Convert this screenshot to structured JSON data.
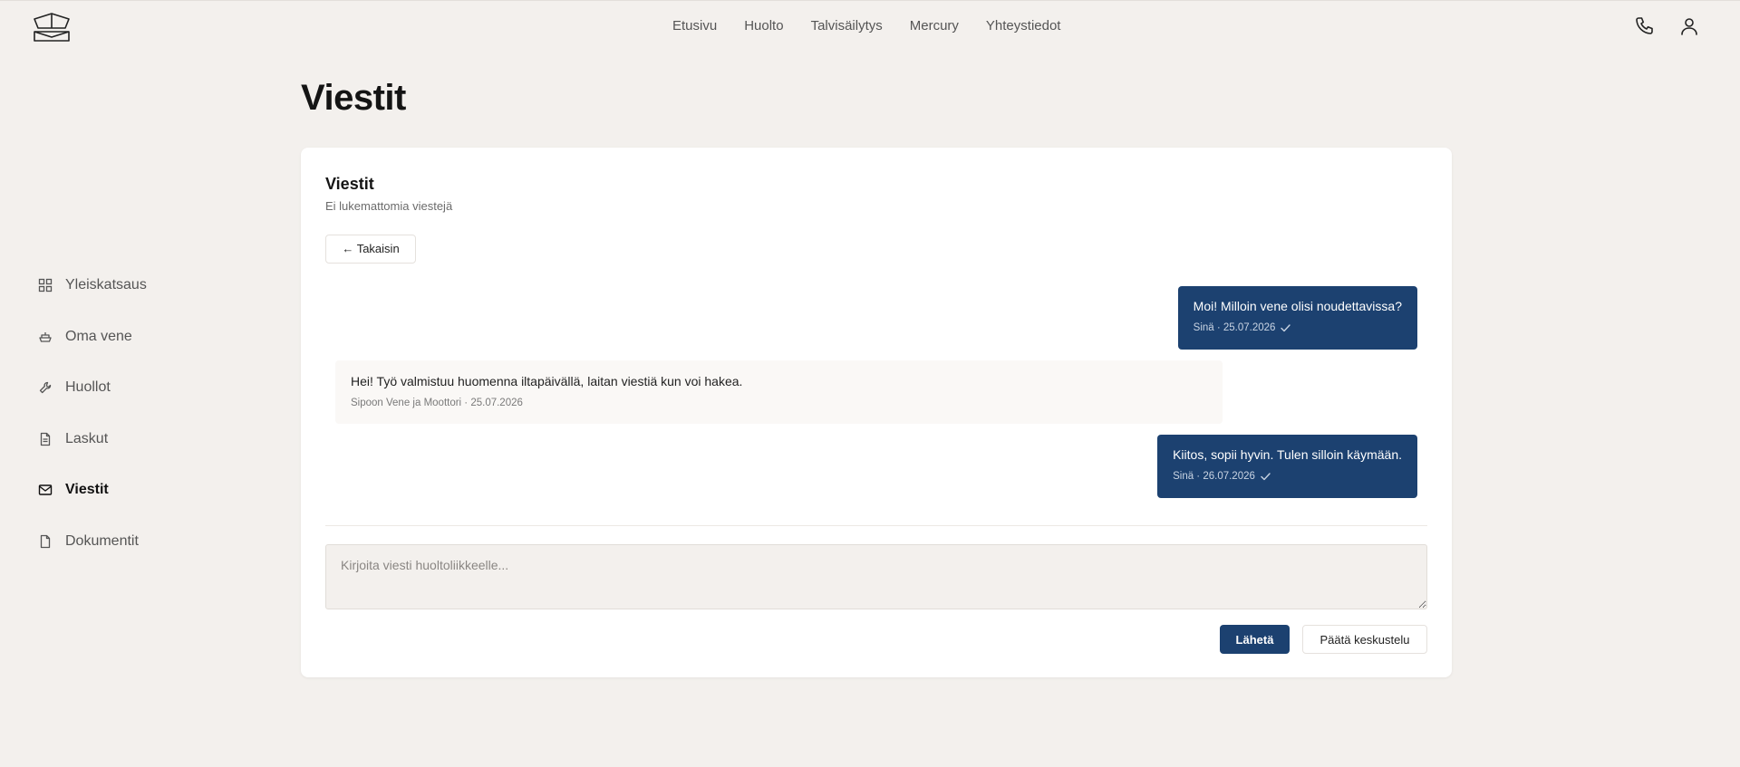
{
  "nav": {
    "items": [
      "Etusivu",
      "Huolto",
      "Talvisäilytys",
      "Mercury",
      "Yhteystiedot"
    ]
  },
  "header_icons": [
    "phone-icon",
    "user-icon"
  ],
  "sidebar": {
    "items": [
      {
        "label": "Yleiskatsaus",
        "icon": "grid-icon",
        "active": false
      },
      {
        "label": "Oma vene",
        "icon": "boat-icon",
        "active": false
      },
      {
        "label": "Huollot",
        "icon": "wrench-icon",
        "active": false
      },
      {
        "label": "Laskut",
        "icon": "invoice-icon",
        "active": false
      },
      {
        "label": "Viestit",
        "icon": "mail-icon",
        "active": true
      },
      {
        "label": "Dokumentit",
        "icon": "document-icon",
        "active": false
      }
    ]
  },
  "page": {
    "title": "Viestit"
  },
  "card": {
    "title": "Viestit",
    "subtitle": "Ei lukemattomia viestejä",
    "back_label": "← Takaisin"
  },
  "messages": [
    {
      "direction": "out",
      "text": "Moi! Milloin vene olisi noudettavissa?",
      "meta": "Sinä · 25.07.2026",
      "read": true
    },
    {
      "direction": "in",
      "text": "Hei! Työ valmistuu huomenna iltapäivällä, laitan viestiä kun voi hakea.",
      "meta": "Sipoon Vene ja Moottori · 25.07.2026"
    },
    {
      "direction": "out",
      "text": "Kiitos, sopii hyvin. Tulen silloin käymään.",
      "meta": "Sinä · 26.07.2026",
      "read": true
    }
  ],
  "composer": {
    "placeholder": "Kirjoita viesti huoltoliikkeelle...",
    "value": "",
    "send_label": "Lähetä",
    "end_label": "Päätä keskustelu"
  },
  "colors": {
    "background": "#f3f0ed",
    "accent": "#1c4170",
    "card": "#ffffff"
  }
}
